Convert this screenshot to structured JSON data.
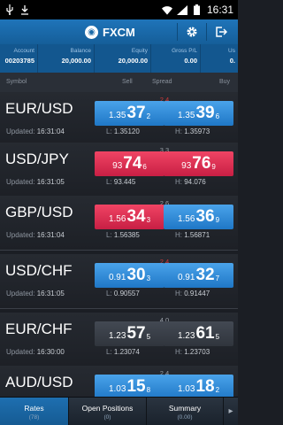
{
  "status_bar": {
    "time": "16:31"
  },
  "app": {
    "title": "FXCM",
    "logo_icon": "fxcm-logo-icon"
  },
  "account": [
    {
      "label": "Account",
      "value": "00203785"
    },
    {
      "label": "Balance",
      "value": "20,000.00"
    },
    {
      "label": "Equity",
      "value": "20,000.00"
    },
    {
      "label": "Gross P/L",
      "value": "0.00"
    },
    {
      "label": "Us",
      "value": "0."
    }
  ],
  "columns": {
    "symbol": "Symbol",
    "sell": "Sell",
    "spread": "Spread",
    "buy": "Buy"
  },
  "rates": [
    {
      "pair": "EUR/USD",
      "updated_label": "Updated:",
      "time": "16:31:04",
      "spread": "2.4",
      "spread_dir": "down",
      "sell": {
        "pre": "1.35",
        "big": "37",
        "pip": "2",
        "color": "blue"
      },
      "buy": {
        "pre": "1.35",
        "big": "39",
        "pip": "6",
        "color": "blue"
      },
      "low_label": "L:",
      "low": "1.35120",
      "high_label": "H:",
      "high": "1.35973"
    },
    {
      "pair": "USD/JPY",
      "updated_label": "Updated:",
      "time": "16:31:05",
      "spread": "3.3",
      "spread_dir": "neutral",
      "sell": {
        "pre": "93",
        "big": "74",
        "pip": "6",
        "color": "red"
      },
      "buy": {
        "pre": "93",
        "big": "76",
        "pip": "9",
        "color": "red"
      },
      "low_label": "L:",
      "low": "93.445",
      "high_label": "H:",
      "high": "94.076"
    },
    {
      "pair": "GBP/USD",
      "updated_label": "Updated:",
      "time": "16:31:04",
      "spread": "2.6",
      "spread_dir": "neutral",
      "sell": {
        "pre": "1.56",
        "big": "34",
        "pip": "3",
        "color": "red"
      },
      "buy": {
        "pre": "1.56",
        "big": "36",
        "pip": "9",
        "color": "blue"
      },
      "low_label": "L:",
      "low": "1.56385",
      "high_label": "H:",
      "high": "1.56871"
    },
    {
      "pair": "USD/CHF",
      "updated_label": "Updated:",
      "time": "16:31:05",
      "spread": "2.4",
      "spread_dir": "down",
      "sell": {
        "pre": "0.91",
        "big": "30",
        "pip": "3",
        "color": "blue"
      },
      "buy": {
        "pre": "0.91",
        "big": "32",
        "pip": "7",
        "color": "blue"
      },
      "low_label": "L:",
      "low": "0.90557",
      "high_label": "H:",
      "high": "0.91447"
    },
    {
      "pair": "EUR/CHF",
      "updated_label": "Updated:",
      "time": "16:30:00",
      "spread": "4.0",
      "spread_dir": "neutral",
      "sell": {
        "pre": "1.23",
        "big": "57",
        "pip": "5",
        "color": "gray"
      },
      "buy": {
        "pre": "1.23",
        "big": "61",
        "pip": "5",
        "color": "gray"
      },
      "low_label": "L:",
      "low": "1.23074",
      "high_label": "H:",
      "high": "1.23703"
    },
    {
      "pair": "AUD/USD",
      "updated_label": "Updated:",
      "time": "",
      "spread": "2.4",
      "spread_dir": "neutral",
      "sell": {
        "pre": "1.03",
        "big": "15",
        "pip": "8",
        "color": "blue"
      },
      "buy": {
        "pre": "1.03",
        "big": "18",
        "pip": "2",
        "color": "blue"
      },
      "low_label": "",
      "low": "",
      "high_label": "",
      "high": ""
    }
  ],
  "tabs": [
    {
      "label": "Rates",
      "sub": "(78)",
      "active": true
    },
    {
      "label": "Open Positions",
      "sub": "(0)",
      "active": false
    },
    {
      "label": "Summary",
      "sub": "(0.00)",
      "active": false
    }
  ],
  "colors": {
    "appbar": "#1b6aa8",
    "blue_price": "#2f8be0",
    "red_price": "#e0314f",
    "gray_price": "#3a4049",
    "spread_down": "#d63a3a"
  }
}
